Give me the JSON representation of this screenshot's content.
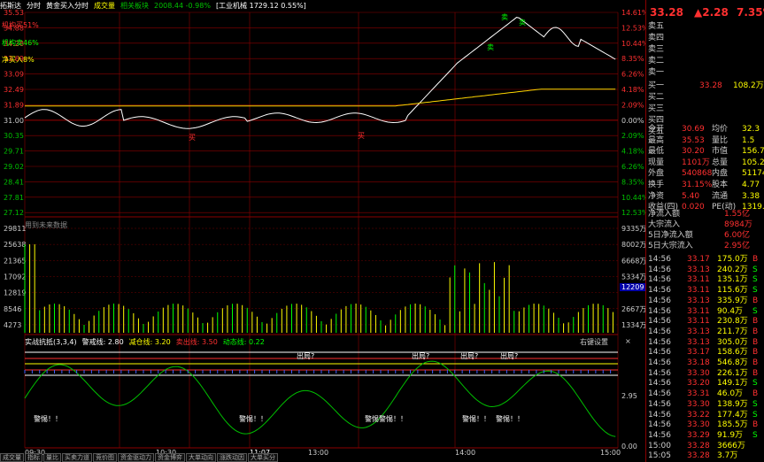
{
  "header": {
    "items": [
      "拓斯达",
      "分时",
      "黄金买入分时",
      "成交量",
      "相关板块",
      "2008.44 -0.98%",
      "[工业机械 1729.12 0.55%]"
    ],
    "colors": [
      "#ffffff",
      "#ffffff",
      "#ffffff",
      "#ffff00",
      "#00c000",
      "#00c000",
      "#ffffff"
    ]
  },
  "signals": {
    "main_buy": "机构买51%",
    "main_sell": "机构卖46%",
    "net_buy": "净买入8%",
    "buy_mark": "买",
    "sell_mark": "卖"
  },
  "price_axis": {
    "left": [
      "35.53",
      "34.88",
      "34.28",
      "33.69",
      "33.09",
      "32.49",
      "31.89",
      "31.00",
      "30.35",
      "29.71",
      "29.02",
      "28.41",
      "27.81",
      "27.12"
    ],
    "right": [
      "14.61%",
      "12.53%",
      "10.44%",
      "8.35%",
      "6.26%",
      "4.18%",
      "2.09%",
      "0.00%",
      "2.09%",
      "4.18%",
      "6.26%",
      "8.35%",
      "10.44%",
      "12.53%"
    ]
  },
  "volume_panel": {
    "label": "用到未来数据",
    "left": [
      "29811",
      "25638",
      "21365",
      "17092",
      "12819",
      "8546",
      "4273"
    ],
    "right": [
      "9335万",
      "8002万",
      "6668万",
      "5334万",
      "",
      "2667万",
      "1334万"
    ],
    "current": "12209"
  },
  "indicator_panel": {
    "title": "实战抗抵(3,3,4)",
    "params": [
      {
        "label": "警戒线: 2.80",
        "color": "#ffffff"
      },
      {
        "label": "减仓线: 3.20",
        "color": "#ffff00"
      },
      {
        "label": "卖出线: 3.50",
        "color": "#ff3030"
      },
      {
        "label": "动态线: 0.22",
        "color": "#00ff00"
      }
    ],
    "right_label": "右键设置",
    "close": "×",
    "axis": "2.95",
    "axis2": "0.00",
    "out_labels": [
      "出局?",
      "出局?",
      "出局?",
      "出局?",
      "出局?"
    ],
    "warn_labels": [
      "警惕！！",
      "警惕！！",
      "警惕警惕！！",
      "警惕！！",
      "警惕！！"
    ]
  },
  "time_axis": [
    "09:30",
    "10:30",
    "11:07",
    "13:00",
    "14:00",
    "15:00"
  ],
  "bottom_tabs": [
    "成交量",
    "指标",
    "量比",
    "买卖力道",
    "竞价图",
    "资金驱动力",
    "资金博弈",
    "大单动向",
    "涨跌动因",
    "大单买分"
  ],
  "quote": {
    "price": "33.28",
    "change": "▲2.28",
    "pct": "7.35%",
    "asks": [
      {
        "label": "卖五",
        "val": "",
        "vol": ""
      },
      {
        "label": "卖四",
        "val": "",
        "vol": ""
      },
      {
        "label": "卖三",
        "val": "",
        "vol": ""
      },
      {
        "label": "卖二",
        "val": "",
        "vol": ""
      },
      {
        "label": "卖一",
        "val": "",
        "vol": ""
      }
    ],
    "bids": [
      {
        "label": "买一",
        "val": "33.28",
        "vol": "108.2万"
      },
      {
        "label": "买二",
        "val": "",
        "vol": ""
      },
      {
        "label": "买三",
        "val": "",
        "vol": ""
      },
      {
        "label": "买四",
        "val": "",
        "vol": ""
      },
      {
        "label": "买五",
        "val": "",
        "vol": ""
      }
    ],
    "stats": [
      {
        "l1": "今开",
        "v1": "30.69",
        "l2": "均价",
        "v2": "32.3"
      },
      {
        "l1": "最高",
        "v1": "35.53",
        "l2": "量比",
        "v2": "1.5"
      },
      {
        "l1": "最低",
        "v1": "30.20",
        "l2": "市值",
        "v2": "156.7"
      },
      {
        "l1": "现量",
        "v1": "1101万",
        "l2": "总量",
        "v2": "105.2"
      },
      {
        "l1": "外盘",
        "v1": "540868",
        "l2": "内盘",
        "v2": "51174"
      },
      {
        "l1": "换手",
        "v1": "31.15%",
        "l2": "股本",
        "v2": "4.77"
      },
      {
        "l1": "净资",
        "v1": "5.40",
        "l2": "流通",
        "v2": "3.38"
      },
      {
        "l1": "收益(四)",
        "v1": "0.020",
        "l2": "PE(动)",
        "v2": "1319."
      }
    ],
    "flows": [
      {
        "label": "净流入额",
        "val": "1.55亿",
        "color": "#ff3030"
      },
      {
        "label": "大宗流入",
        "val": "8984万",
        "color": "#ff3030"
      },
      {
        "label": "5日净流入额",
        "val": "6.00亿",
        "color": "#ff3030"
      },
      {
        "label": "5日大宗流入",
        "val": "2.95亿",
        "color": "#ff3030"
      }
    ],
    "ticks": [
      {
        "t": "14:56",
        "p": "33.17",
        "v": "175.0万",
        "s": "B"
      },
      {
        "t": "14:56",
        "p": "33.13",
        "v": "240.2万",
        "s": "S"
      },
      {
        "t": "14:56",
        "p": "33.11",
        "v": "135.1万",
        "s": "S"
      },
      {
        "t": "14:56",
        "p": "33.11",
        "v": "115.6万",
        "s": "S"
      },
      {
        "t": "14:56",
        "p": "33.13",
        "v": "335.9万",
        "s": "B"
      },
      {
        "t": "14:56",
        "p": "33.11",
        "v": "90.4万",
        "s": "S"
      },
      {
        "t": "14:56",
        "p": "33.11",
        "v": "230.8万",
        "s": "B"
      },
      {
        "t": "14:56",
        "p": "33.13",
        "v": "211.7万",
        "s": "B"
      },
      {
        "t": "14:56",
        "p": "33.13",
        "v": "305.0万",
        "s": "B"
      },
      {
        "t": "14:56",
        "p": "33.17",
        "v": "158.6万",
        "s": "B"
      },
      {
        "t": "14:56",
        "p": "33.18",
        "v": "546.8万",
        "s": "B"
      },
      {
        "t": "14:56",
        "p": "33.30",
        "v": "226.1万",
        "s": "B"
      },
      {
        "t": "14:56",
        "p": "33.20",
        "v": "149.1万",
        "s": "S"
      },
      {
        "t": "14:56",
        "p": "33.31",
        "v": "46.0万",
        "s": "B"
      },
      {
        "t": "14:56",
        "p": "33.30",
        "v": "138.9万",
        "s": "S"
      },
      {
        "t": "14:56",
        "p": "33.22",
        "v": "177.4万",
        "s": "S"
      },
      {
        "t": "14:56",
        "p": "33.30",
        "v": "185.5万",
        "s": "B"
      },
      {
        "t": "14:56",
        "p": "33.29",
        "v": "91.9万",
        "s": "S"
      },
      {
        "t": "15:00",
        "p": "33.28",
        "v": "3666万",
        "s": ""
      },
      {
        "t": "15:05",
        "p": "33.28",
        "v": "3.7万",
        "s": ""
      }
    ]
  },
  "colors": {
    "up": "#ff3030",
    "down": "#00ff00",
    "grid": "#8b0000",
    "price_line": "#ffffff",
    "avg_line": "#ffd700"
  }
}
